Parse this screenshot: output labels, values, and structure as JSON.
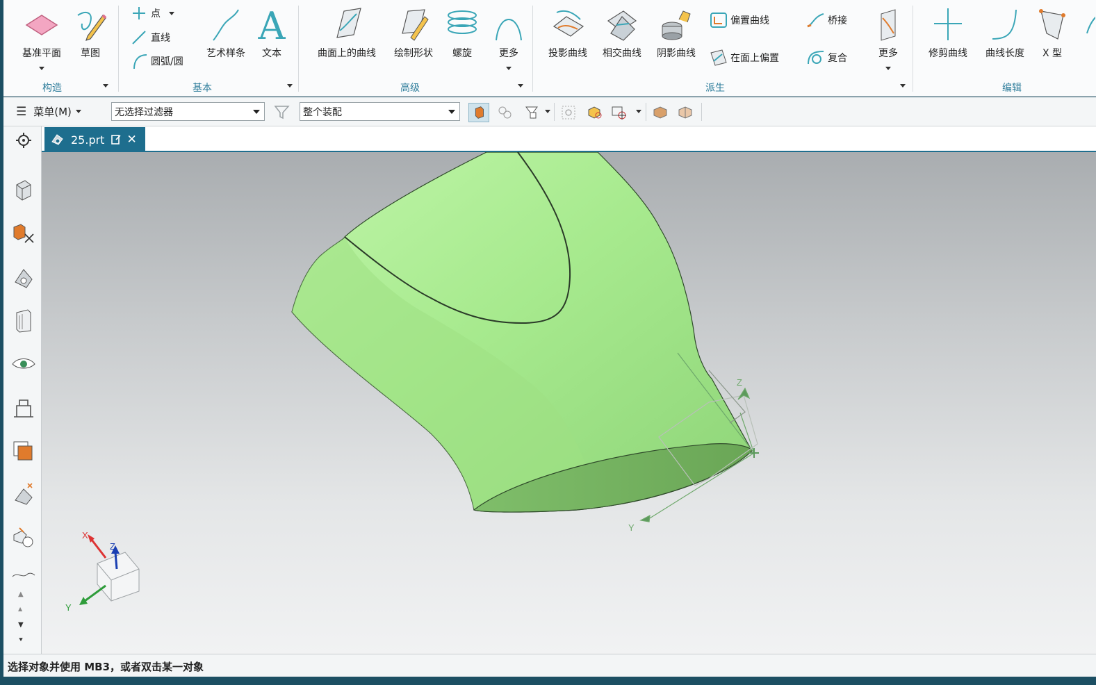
{
  "ribbon": {
    "groups": {
      "construct": {
        "label": "构造",
        "buttons": {
          "datum_plane": "基准平面",
          "sketch": "草图"
        }
      },
      "basic": {
        "label": "基本",
        "point": "点",
        "line": "直线",
        "arc_circle": "圆弧/圆",
        "studio_spline": "艺术样条",
        "text": "文本"
      },
      "advanced": {
        "label": "高级",
        "curve_on_surface": "曲面上的曲线",
        "sketch_shape": "绘制形状",
        "helix": "螺旋",
        "more": "更多"
      },
      "derived": {
        "label": "派生",
        "project_curve": "投影曲线",
        "intersection_curve": "相交曲线",
        "shadow_curve": "阴影曲线",
        "offset_curve": "偏置曲线",
        "offset_on_face": "在面上偏置",
        "bridge": "桥接",
        "composite": "复合",
        "more": "更多"
      },
      "edit": {
        "label": "编辑",
        "trim_curve": "修剪曲线",
        "curve_length": "曲线长度",
        "x_form": "X 型"
      }
    }
  },
  "selbar": {
    "menu_label": "菜单(M)",
    "type_filter": "无选择过滤器",
    "scope": "整个装配"
  },
  "tabs": [
    {
      "label": "25.prt"
    }
  ],
  "status": {
    "text": "选择对象并使用 MB3，或者双击某一对象"
  },
  "viewport": {
    "model_color": "#a4ea8c",
    "triad": {
      "x": "X",
      "y": "Y",
      "z": "Z"
    },
    "csys": {
      "y": "Y",
      "z": "Z"
    }
  }
}
